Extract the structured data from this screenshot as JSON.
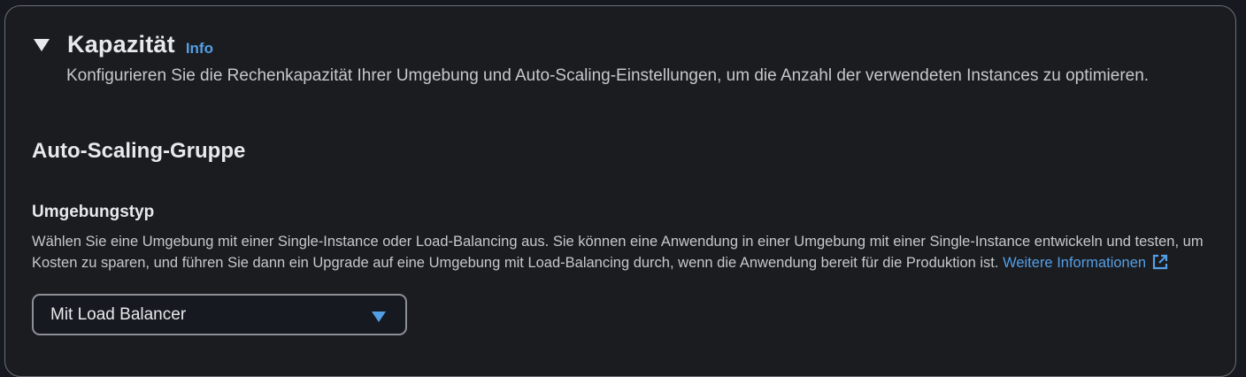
{
  "capacity": {
    "title": "Kapazität",
    "info_label": "Info",
    "description": "Konfigurieren Sie die Rechenkapazität Ihrer Umgebung und Auto-Scaling-Einstellungen, um die Anzahl der verwendeten Instances zu optimieren.",
    "expanded": true
  },
  "auto_scaling": {
    "section_title": "Auto-Scaling-Gruppe",
    "environment_type": {
      "label": "Umgebungstyp",
      "description": "Wählen Sie eine Umgebung mit einer Single-Instance oder Load-Balancing aus. Sie können eine Anwendung in einer Umgebung mit einer Single-Instance entwickeln und testen, um Kosten zu sparen, und führen Sie dann ein Upgrade auf eine Umgebung mit Load-Balancing durch, wenn die Anwendung bereit für die Produktion ist.",
      "learn_more_label": "Weitere Informationen",
      "selected_value": "Mit Load Balancer"
    }
  },
  "icons": {
    "collapse": "caret-down-icon",
    "external_link": "external-link-icon",
    "dropdown": "triangle-down-icon"
  },
  "colors": {
    "link": "#539fe5",
    "panel_background": "#1b1c20",
    "border": "#6b6f78"
  }
}
